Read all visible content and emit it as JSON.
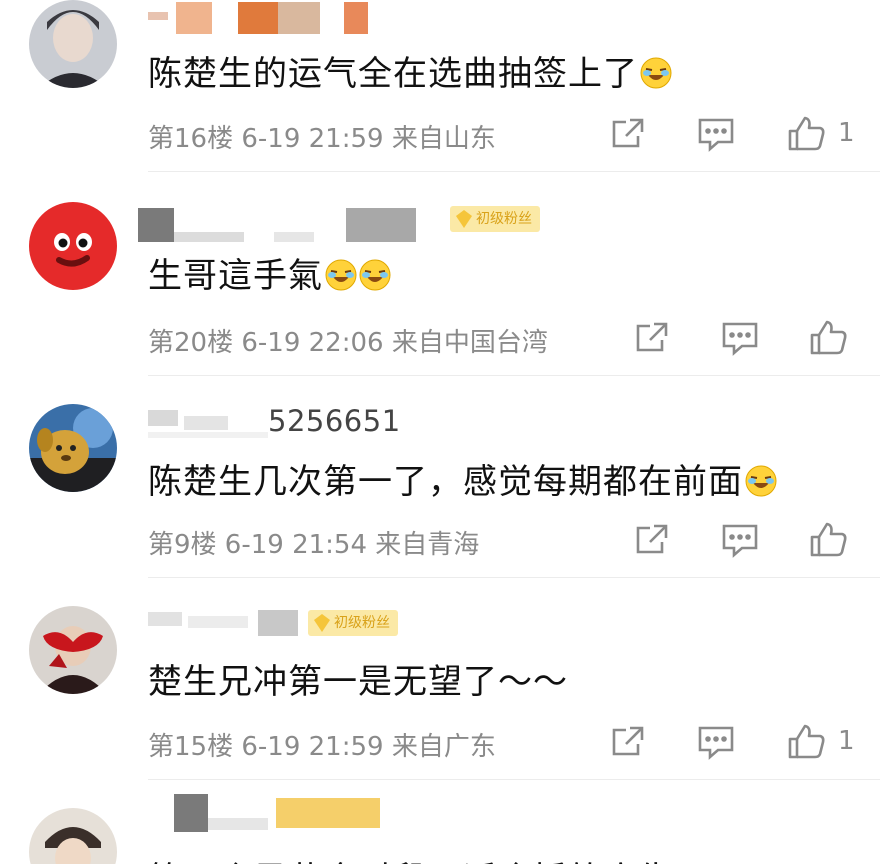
{
  "comments": [
    {
      "text": "陈楚生的运气全在选曲抽签上了",
      "meta": "第16楼 6-19 21:59 来自山东",
      "like_count": "1",
      "emoji": "laugh-cry-emoji"
    },
    {
      "text": "生哥這手氣",
      "meta": "第20楼 6-19 22:06 来自中国台湾",
      "like_count": "",
      "badge": "初级粉丝",
      "emoji": "laugh-cry-emoji"
    },
    {
      "username": "5256651",
      "text": "陈楚生几次第一了，感觉每期都在前面",
      "meta": "第9楼 6-19 21:54 来自青海",
      "like_count": "",
      "emoji": "laugh-cry-emoji"
    },
    {
      "text": "楚生兄冲第一是无望了～～",
      "meta": "第15楼 6-19 21:59 来自广东",
      "like_count": "1",
      "badge": "初级粉丝"
    },
    {
      "text": "第一个是黄金时段，适合插放广告"
    }
  ],
  "colors": {
    "meta_gray": "#8a8a8a",
    "badge_bg": "#fbe9a6",
    "badge_text": "#d9a21a"
  },
  "icons": [
    "share-icon",
    "comment-icon",
    "thumbs-up-icon"
  ]
}
